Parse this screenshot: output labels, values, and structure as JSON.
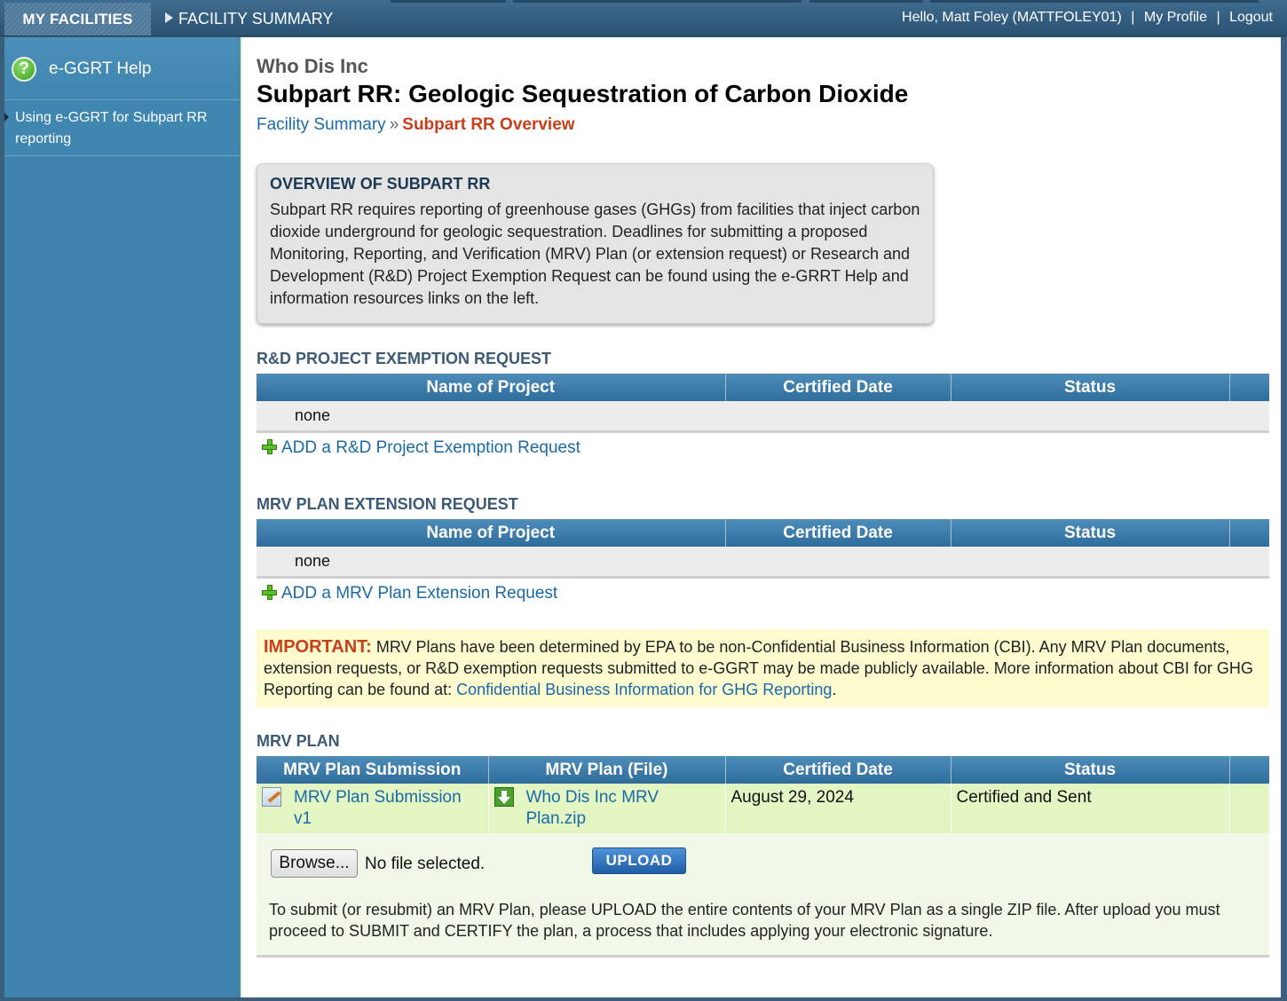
{
  "nav": {
    "my_facilities": "MY FACILITIES",
    "facility_summary": "FACILITY SUMMARY",
    "greeting": "Hello, Matt Foley (MATTFOLEY01)",
    "separator": "|",
    "my_profile": "My Profile",
    "logout": "Logout"
  },
  "sidebar": {
    "help_title": "e-GGRT Help",
    "help_icon": "?",
    "links": [
      {
        "label": "Using e-GGRT for Subpart RR reporting"
      }
    ]
  },
  "header": {
    "organization": "Who Dis Inc",
    "title": "Subpart RR: Geologic Sequestration of Carbon Dioxide",
    "breadcrumb_link": "Facility Summary",
    "breadcrumb_sep": "»",
    "breadcrumb_current": "Subpart RR Overview"
  },
  "overview": {
    "heading": "OVERVIEW OF SUBPART RR",
    "text": "Subpart RR requires reporting of greenhouse gases (GHGs) from facilities that inject carbon dioxide underground for geologic sequestration. Deadlines for submitting a proposed Monitoring, Reporting, and Verification (MRV) Plan (or extension request) or Research and Development (R&D) Project Exemption Request can be found using the e-GRRT Help and information resources links on the left."
  },
  "rd_section": {
    "heading": "R&D PROJECT EXEMPTION REQUEST",
    "columns": [
      "Name of Project",
      "Certified Date",
      "Status"
    ],
    "empty_text": "none",
    "add_link": "ADD a R&D Project Exemption Request"
  },
  "ext_section": {
    "heading": "MRV PLAN EXTENSION REQUEST",
    "columns": [
      "Name of Project",
      "Certified Date",
      "Status"
    ],
    "empty_text": "none",
    "add_link": "ADD a MRV Plan Extension Request"
  },
  "important": {
    "label": "IMPORTANT:",
    "text": " MRV Plans have been determined by EPA to be non-Confidential Business Information (CBI). Any MRV Plan documents, extension requests, or R&D exemption requests submitted to e-GGRT may be made publicly available. More information about CBI for GHG Reporting can be found at: ",
    "link": "Confidential Business Information for GHG Reporting",
    "end": "."
  },
  "mrv_plan": {
    "heading": "MRV PLAN",
    "columns": [
      "MRV Plan Submission",
      "MRV Plan (File)",
      "Certified Date",
      "Status"
    ],
    "rows": [
      {
        "submission": "MRV Plan Submission v1",
        "submission_icon": "edit-document-icon",
        "file": "Who Dis Inc MRV Plan.zip",
        "file_icon": "download-arrow-icon",
        "certified_date": "August 29, 2024",
        "status": "Certified and Sent"
      }
    ],
    "browse_label": "Browse...",
    "file_status": "No file selected.",
    "upload_label": "UPLOAD",
    "note": "To submit (or resubmit) an MRV Plan, please UPLOAD the entire contents of your MRV Plan as a single ZIP file. After upload you must proceed to SUBMIT and CERTIFY the plan, a process that includes applying your electronic signature."
  },
  "colors": {
    "header_bar": "#2f5a7d",
    "sidebar": "#3e84ad",
    "table_header": "#3c7fae",
    "link": "#1a6aa8",
    "accent_red": "#c8401a",
    "important_bg": "#fdfbcf",
    "row_green": "#e4f5c4"
  }
}
